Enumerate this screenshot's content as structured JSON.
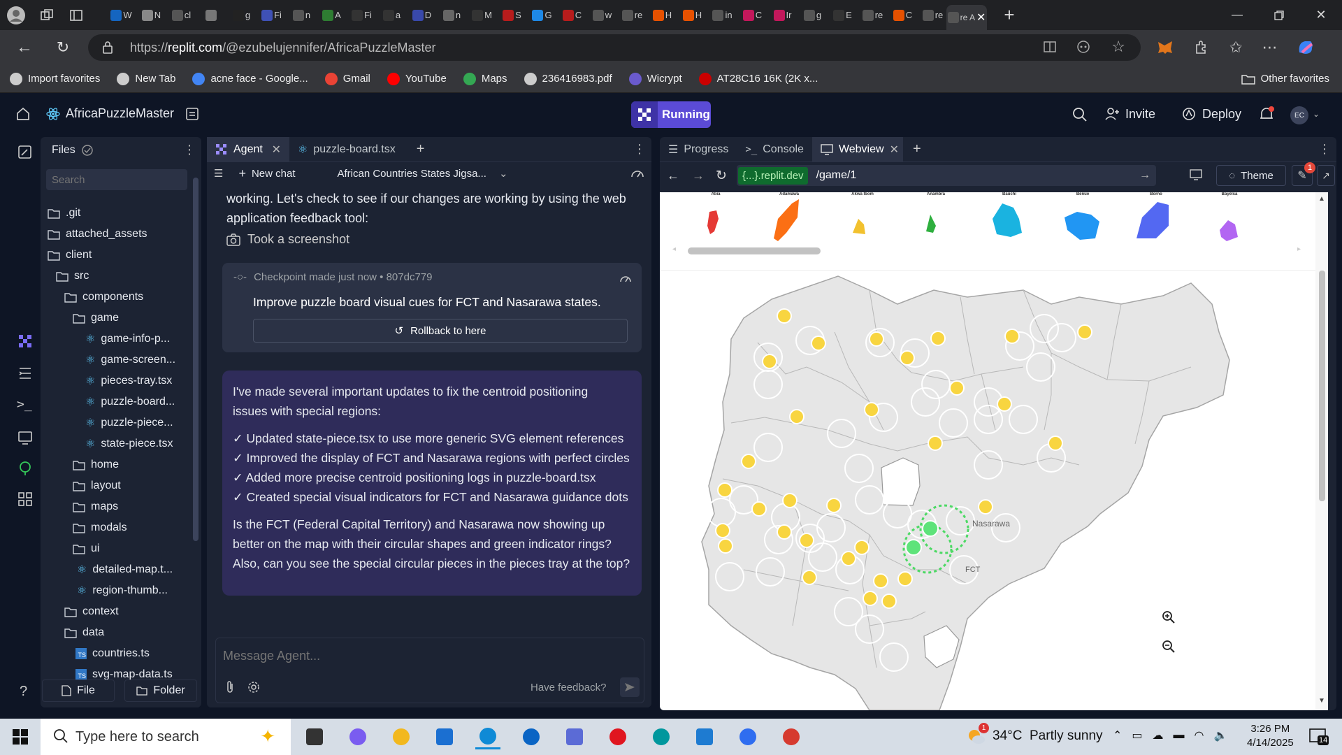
{
  "browser": {
    "url_prefix": "https://",
    "url_domain": "replit.com",
    "url_path": "/@ezubelujennifer/AfricaPuzzleMaster",
    "tabs": [
      {
        "text": "W",
        "color": "#1565c0"
      },
      {
        "text": "N",
        "color": "#888"
      },
      {
        "text": "cl",
        "color": "#555"
      },
      {
        "text": "",
        "color": "#777"
      },
      {
        "text": "g",
        "color": "#222"
      },
      {
        "text": "Fi",
        "color": "#3f51b5"
      },
      {
        "text": "n",
        "color": "#555"
      },
      {
        "text": "A",
        "color": "#2e7d32"
      },
      {
        "text": "Fi",
        "color": "#333"
      },
      {
        "text": "a",
        "color": "#333"
      },
      {
        "text": "D",
        "color": "#3949ab"
      },
      {
        "text": "n",
        "color": "#666"
      },
      {
        "text": "M",
        "color": "#333"
      },
      {
        "text": "S",
        "color": "#b71c1c"
      },
      {
        "text": "G",
        "color": "#1e88e5"
      },
      {
        "text": "C",
        "color": "#b71c1c"
      },
      {
        "text": "w",
        "color": "#555"
      },
      {
        "text": "re",
        "color": "#555"
      },
      {
        "text": "H",
        "color": "#e65100"
      },
      {
        "text": "H",
        "color": "#e65100"
      },
      {
        "text": "in",
        "color": "#555"
      },
      {
        "text": "C",
        "color": "#c2185b"
      },
      {
        "text": "Ir",
        "color": "#c2185b"
      },
      {
        "text": "g",
        "color": "#555"
      },
      {
        "text": "E",
        "color": "#333"
      },
      {
        "text": "re",
        "color": "#555"
      },
      {
        "text": "C",
        "color": "#e65100"
      },
      {
        "text": "re",
        "color": "#555"
      }
    ],
    "active_tab": {
      "text": "re A"
    },
    "bookmarks": [
      {
        "label": "Import favorites",
        "color": "#ccc"
      },
      {
        "label": "New Tab",
        "color": "#ccc"
      },
      {
        "label": "acne face - Google...",
        "color": "#4285f4"
      },
      {
        "label": "Gmail",
        "color": "#ea4335"
      },
      {
        "label": "YouTube",
        "color": "#ff0000"
      },
      {
        "label": "Maps",
        "color": "#34a853"
      },
      {
        "label": "236416983.pdf",
        "color": "#ccc"
      },
      {
        "label": "Wicrypt",
        "color": "#6a5acd"
      },
      {
        "label": "AT28C16 16K (2K x...",
        "color": "#c00"
      }
    ],
    "other_favorites": "Other favorites"
  },
  "replit": {
    "project_name": "AfricaPuzzleMaster",
    "run_status": "Running",
    "invite_label": "Invite",
    "deploy_label": "Deploy",
    "avatar_initials": "EC"
  },
  "files": {
    "title": "Files",
    "search_placeholder": "Search",
    "tree": [
      {
        "name": ".git",
        "type": "folder",
        "depth": 0
      },
      {
        "name": "attached_assets",
        "type": "folder",
        "depth": 0
      },
      {
        "name": "client",
        "type": "folder",
        "depth": 0
      },
      {
        "name": "src",
        "type": "folder",
        "depth": 1
      },
      {
        "name": "components",
        "type": "folder",
        "depth": 2
      },
      {
        "name": "game",
        "type": "folder",
        "depth": 3
      },
      {
        "name": "game-info-p...",
        "type": "react",
        "depth": 4
      },
      {
        "name": "game-screen...",
        "type": "react",
        "depth": 4
      },
      {
        "name": "pieces-tray.tsx",
        "type": "react",
        "depth": 4
      },
      {
        "name": "puzzle-board...",
        "type": "react",
        "depth": 4
      },
      {
        "name": "puzzle-piece...",
        "type": "react",
        "depth": 4
      },
      {
        "name": "state-piece.tsx",
        "type": "react",
        "depth": 4
      },
      {
        "name": "home",
        "type": "folder",
        "depth": 3
      },
      {
        "name": "layout",
        "type": "folder",
        "depth": 3
      },
      {
        "name": "maps",
        "type": "folder",
        "depth": 3
      },
      {
        "name": "modals",
        "type": "folder",
        "depth": 3
      },
      {
        "name": "ui",
        "type": "folder",
        "depth": 3
      },
      {
        "name": "detailed-map.t...",
        "type": "react",
        "depth": 3
      },
      {
        "name": "region-thumb...",
        "type": "react",
        "depth": 3
      },
      {
        "name": "context",
        "type": "folder",
        "depth": 2
      },
      {
        "name": "data",
        "type": "folder",
        "depth": 2
      },
      {
        "name": "countries.ts",
        "type": "ts",
        "depth": 3
      },
      {
        "name": "svg-map-data.ts",
        "type": "ts",
        "depth": 3
      }
    ],
    "new_file_label": "File",
    "new_folder_label": "Folder"
  },
  "agent": {
    "tab_agent": "Agent",
    "tab_file": "puzzle-board.tsx",
    "new_chat": "New chat",
    "chat_title": "African Countries States Jigsa...",
    "intro_line1": "working. Let's check to see if our changes are working by using the web",
    "intro_line2": "application feedback tool:",
    "screenshot_note": "Took a screenshot",
    "checkpoint_meta": "Checkpoint made just now • 807dc779",
    "checkpoint_text": "Improve puzzle board visual cues for FCT and Nasarawa states.",
    "rollback_label": "Rollback to here",
    "message": {
      "intro_1": "I've made several important updates to fix the centroid positioning",
      "intro_2": "issues with special regions:",
      "bullets": [
        "✓ Updated state-piece.tsx to use more generic SVG element references",
        "✓ Improved the display of FCT and Nasarawa regions with perfect circles",
        "✓ Added more precise centroid positioning logs in puzzle-board.tsx",
        "✓ Created special visual indicators for FCT and Nasarawa guidance dots"
      ],
      "question_1": "Is the FCT (Federal Capital Territory) and Nasarawa now showing up",
      "question_2": "better on the map with their circular shapes and green indicator rings?",
      "question_3": "Also, can you see the special circular pieces in the pieces tray at the top?"
    },
    "composer_placeholder": "Message Agent...",
    "feedback_label": "Have feedback?"
  },
  "webview": {
    "tabs": {
      "progress": "Progress",
      "console": "Console",
      "webview": "Webview"
    },
    "url_domain": "{...}.replit.dev",
    "url_path": "/game/1",
    "theme_label": "Theme",
    "badge_count": "1",
    "pieces": [
      {
        "label": "Abia",
        "color": "#e53935"
      },
      {
        "label": "Adamawa",
        "color": "#fb6f14"
      },
      {
        "label": "Akwa Ibom",
        "color": "#f2c12e"
      },
      {
        "label": "Anambra",
        "color": "#2eaf3e"
      },
      {
        "label": "Bauchi",
        "color": "#1ab3e0"
      },
      {
        "label": "Benue",
        "color": "#2196f3"
      },
      {
        "label": "Borno",
        "color": "#5368f2"
      },
      {
        "label": "Bayelsa",
        "color": "#b266f2"
      }
    ],
    "map_labels": {
      "nasarawa": "Nasarawa",
      "fct": "FCT"
    }
  },
  "taskbar": {
    "search_placeholder": "Type here to search",
    "weather": "34°C  Partly sunny",
    "weather_badge": "1",
    "time": "3:26 PM",
    "date": "4/14/2025",
    "notifications": "14"
  }
}
